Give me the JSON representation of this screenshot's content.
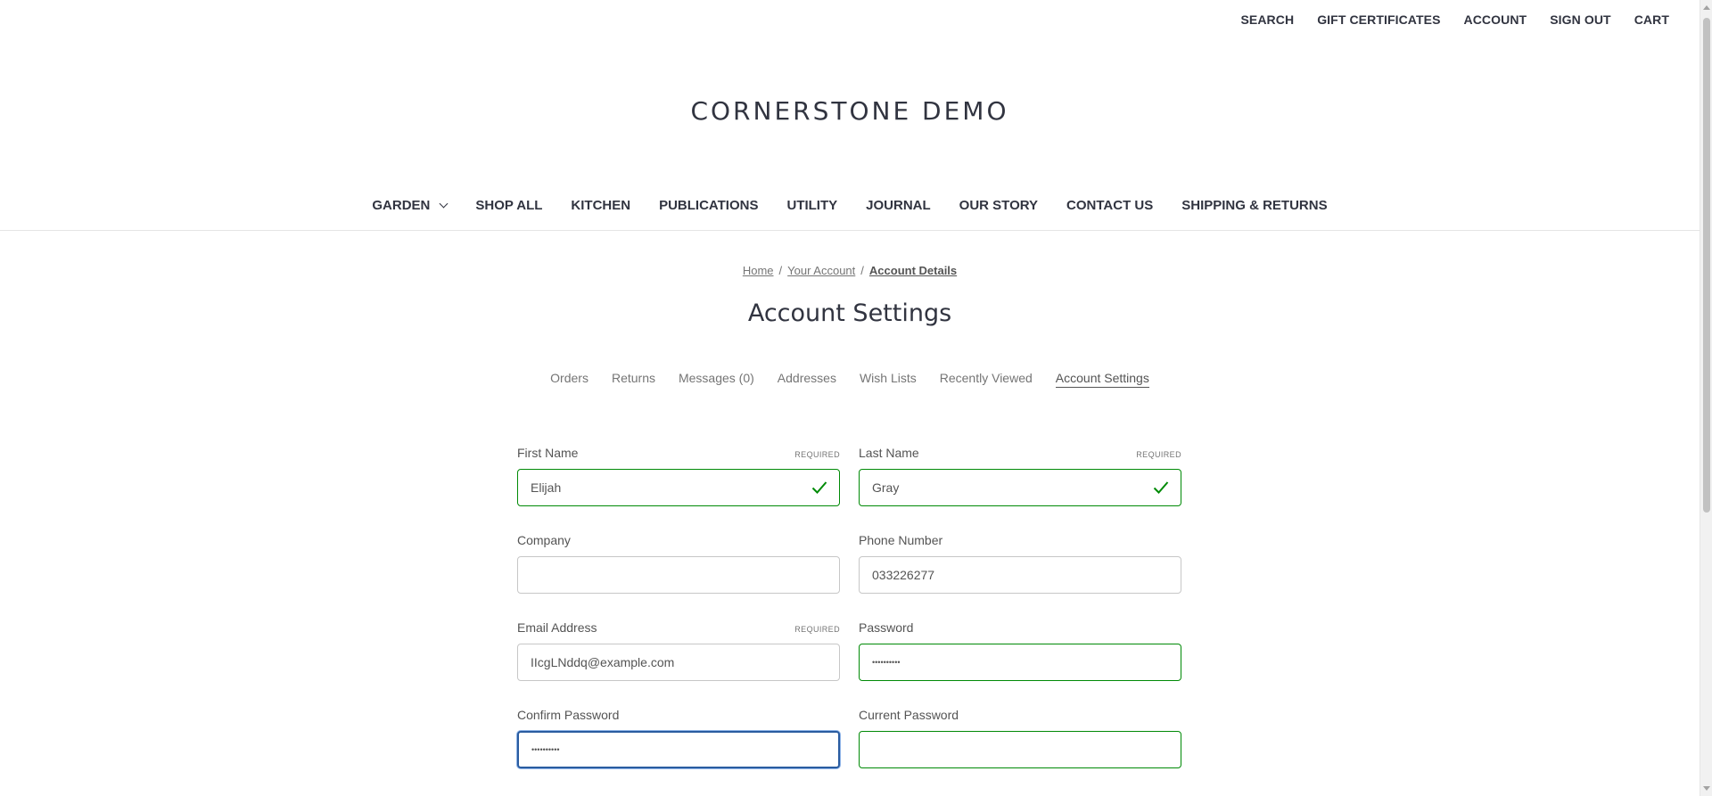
{
  "top_nav": {
    "items": [
      "SEARCH",
      "GIFT CERTIFICATES",
      "ACCOUNT",
      "SIGN OUT",
      "CART"
    ]
  },
  "store": {
    "logo_text": "CORNERSTONE DEMO"
  },
  "main_nav": {
    "items": [
      "GARDEN",
      "SHOP ALL",
      "KITCHEN",
      "PUBLICATIONS",
      "UTILITY",
      "JOURNAL",
      "OUR STORY",
      "CONTACT US",
      "SHIPPING & RETURNS"
    ]
  },
  "breadcrumb": {
    "items": [
      "Home",
      "Your Account",
      "Account Details"
    ],
    "separator": "/"
  },
  "page": {
    "title": "Account Settings"
  },
  "account_tabs": {
    "items": [
      "Orders",
      "Returns",
      "Messages (0)",
      "Addresses",
      "Wish Lists",
      "Recently Viewed",
      "Account Settings"
    ],
    "active": "Account Settings"
  },
  "form": {
    "required_label": "REQUIRED",
    "fields": {
      "first_name": {
        "label": "First Name",
        "value": "Elijah",
        "required": true,
        "state": "success"
      },
      "last_name": {
        "label": "Last Name",
        "value": "Gray",
        "required": true,
        "state": "success"
      },
      "company": {
        "label": "Company",
        "value": ""
      },
      "phone": {
        "label": "Phone Number",
        "value": "033226277"
      },
      "email": {
        "label": "Email Address",
        "value": "IIcgLNddq@example.com",
        "required": true
      },
      "password": {
        "label": "Password",
        "value": "••••••••••",
        "state": "success"
      },
      "confirm_password": {
        "label": "Confirm Password",
        "value": "••••••••••",
        "state": "focused"
      },
      "current_password": {
        "label": "Current Password",
        "value": "",
        "state": "success"
      }
    }
  },
  "colors": {
    "success": "#008a06",
    "focus": "#2a5ca0",
    "text_dark": "#313440",
    "text_body": "#545454"
  },
  "icons": {
    "valid": "check-icon",
    "dropdown": "chevron-down-icon"
  }
}
